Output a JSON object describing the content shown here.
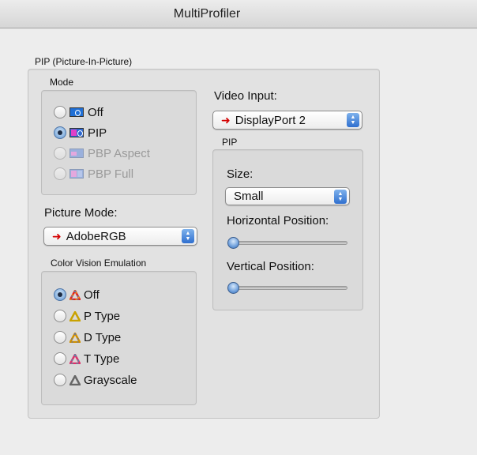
{
  "window": {
    "title": "MultiProfiler"
  },
  "pip_section": {
    "label": "PIP (Picture-In-Picture)",
    "mode": {
      "label": "Mode",
      "options": [
        {
          "label": "Off",
          "icon": "mode-off-icon",
          "selected": false,
          "disabled": false
        },
        {
          "label": "PIP",
          "icon": "mode-pip-icon",
          "selected": true,
          "disabled": false
        },
        {
          "label": "PBP Aspect",
          "icon": "mode-pbp-aspect-icon",
          "selected": false,
          "disabled": true
        },
        {
          "label": "PBP Full",
          "icon": "mode-pbp-full-icon",
          "selected": false,
          "disabled": true
        }
      ]
    },
    "picture_mode": {
      "label": "Picture Mode:",
      "value": "AdobeRGB"
    },
    "color_vision_emulation": {
      "label": "Color Vision Emulation",
      "options": [
        {
          "label": "Off",
          "selected": true
        },
        {
          "label": "P Type",
          "selected": false
        },
        {
          "label": "D Type",
          "selected": false
        },
        {
          "label": "T Type",
          "selected": false
        },
        {
          "label": "Grayscale",
          "selected": false
        }
      ]
    },
    "video_input": {
      "label": "Video Input:",
      "value": "DisplayPort 2"
    },
    "pip": {
      "label": "PIP",
      "size": {
        "label": "Size:",
        "value": "Small"
      },
      "horizontal_position": {
        "label": "Horizontal Position:",
        "value": 0
      },
      "vertical_position": {
        "label": "Vertical Position:",
        "value": 0
      }
    }
  },
  "colors": {
    "accent": "#2f6fcf",
    "selected_indicator": "#d40000"
  }
}
